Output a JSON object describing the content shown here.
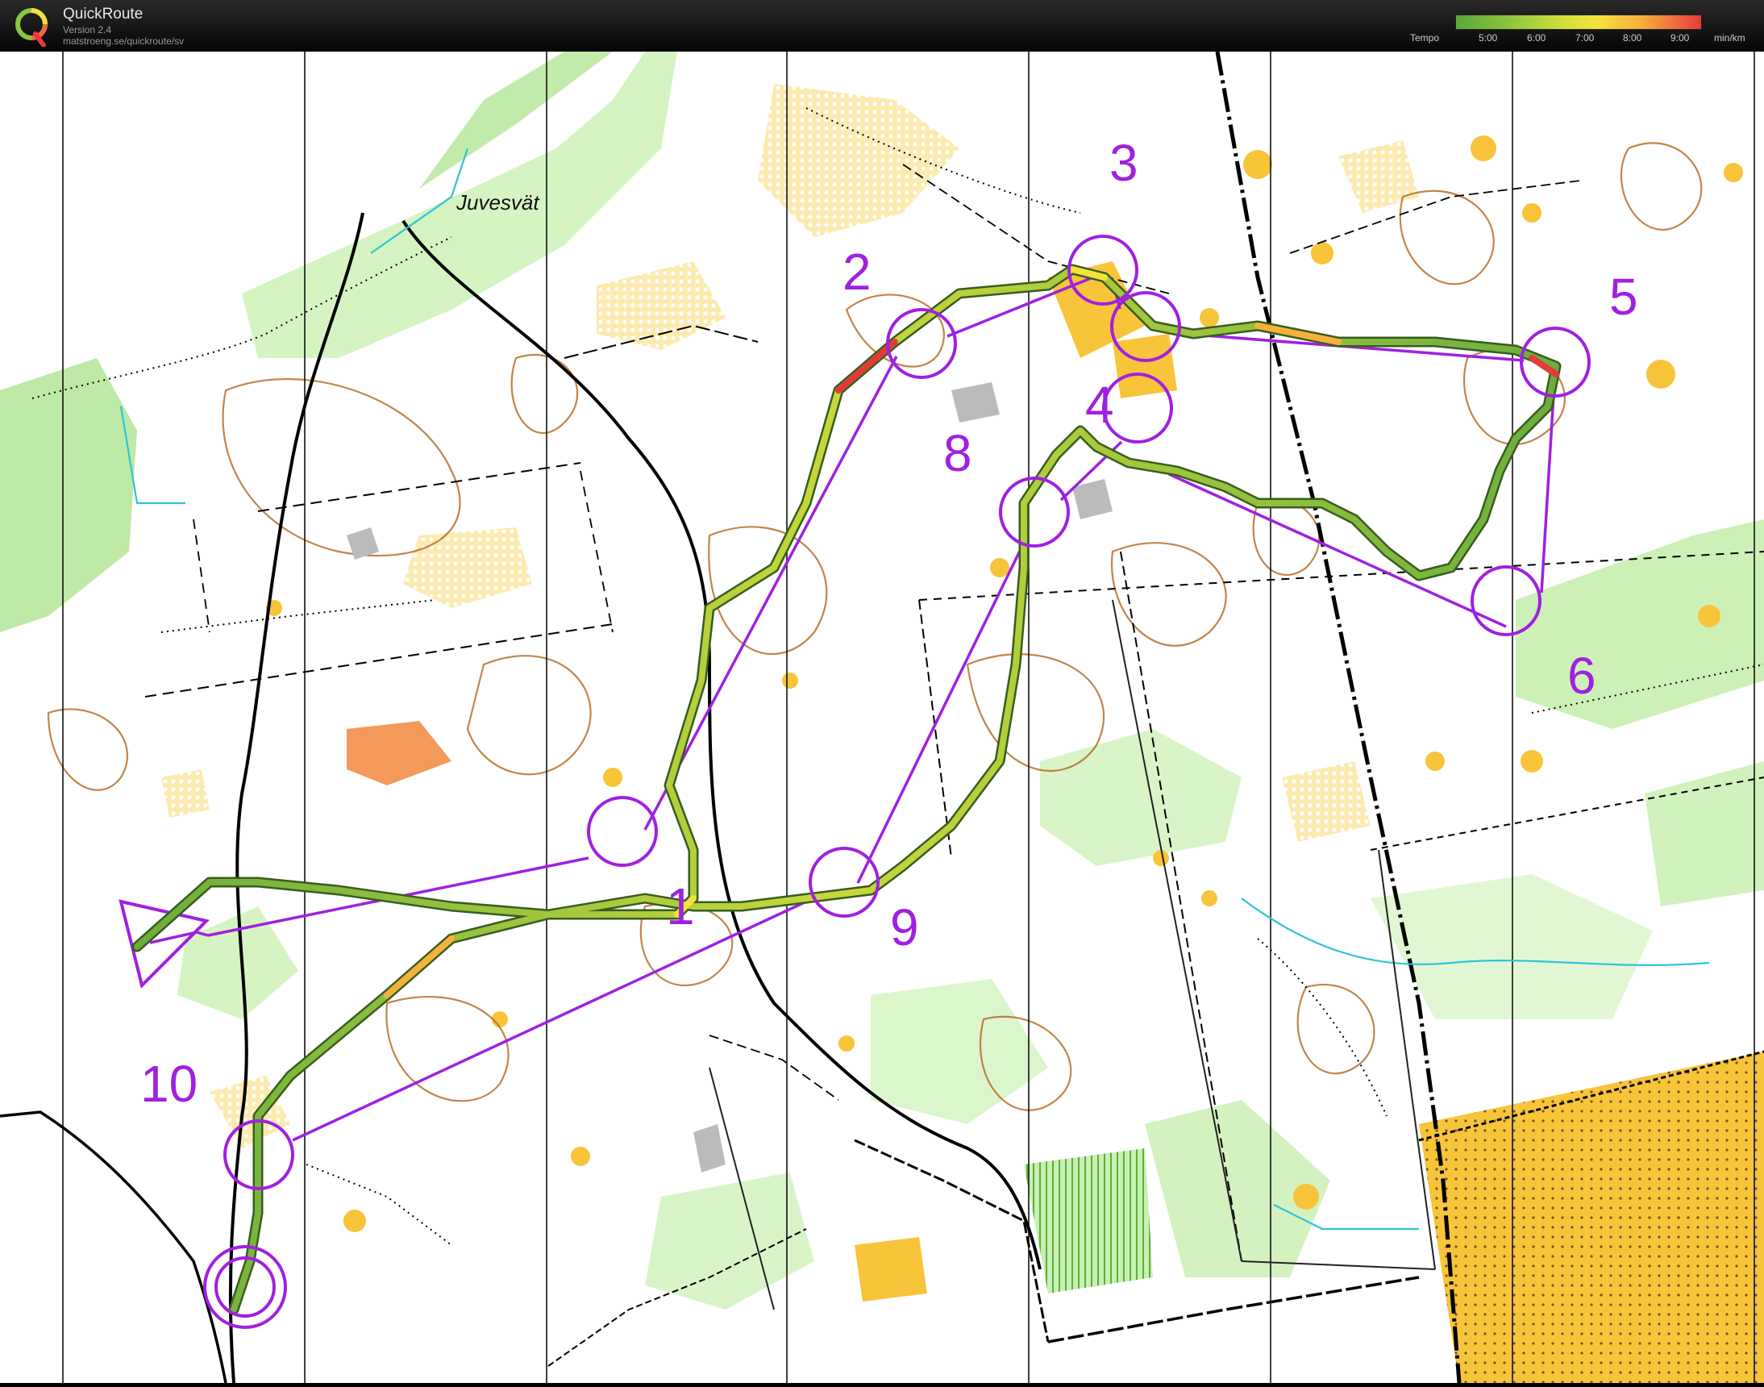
{
  "app": {
    "name": "QuickRoute",
    "version": "Version 2.4",
    "url": "matstroeng.se/quickroute/sv"
  },
  "legend": {
    "label": "Tempo",
    "ticks": [
      "5:00",
      "6:00",
      "7:00",
      "8:00",
      "9:00"
    ],
    "unit": "min/km",
    "colors": [
      "#5aa83a",
      "#8cc63f",
      "#f4e23c",
      "#f6b13b",
      "#e53a3a"
    ]
  },
  "map": {
    "place_name": "Juvesvät",
    "course_color": "#a020e0",
    "controls": [
      "1",
      "2",
      "3",
      "4",
      "5",
      "6",
      "8",
      "9",
      "10"
    ]
  }
}
